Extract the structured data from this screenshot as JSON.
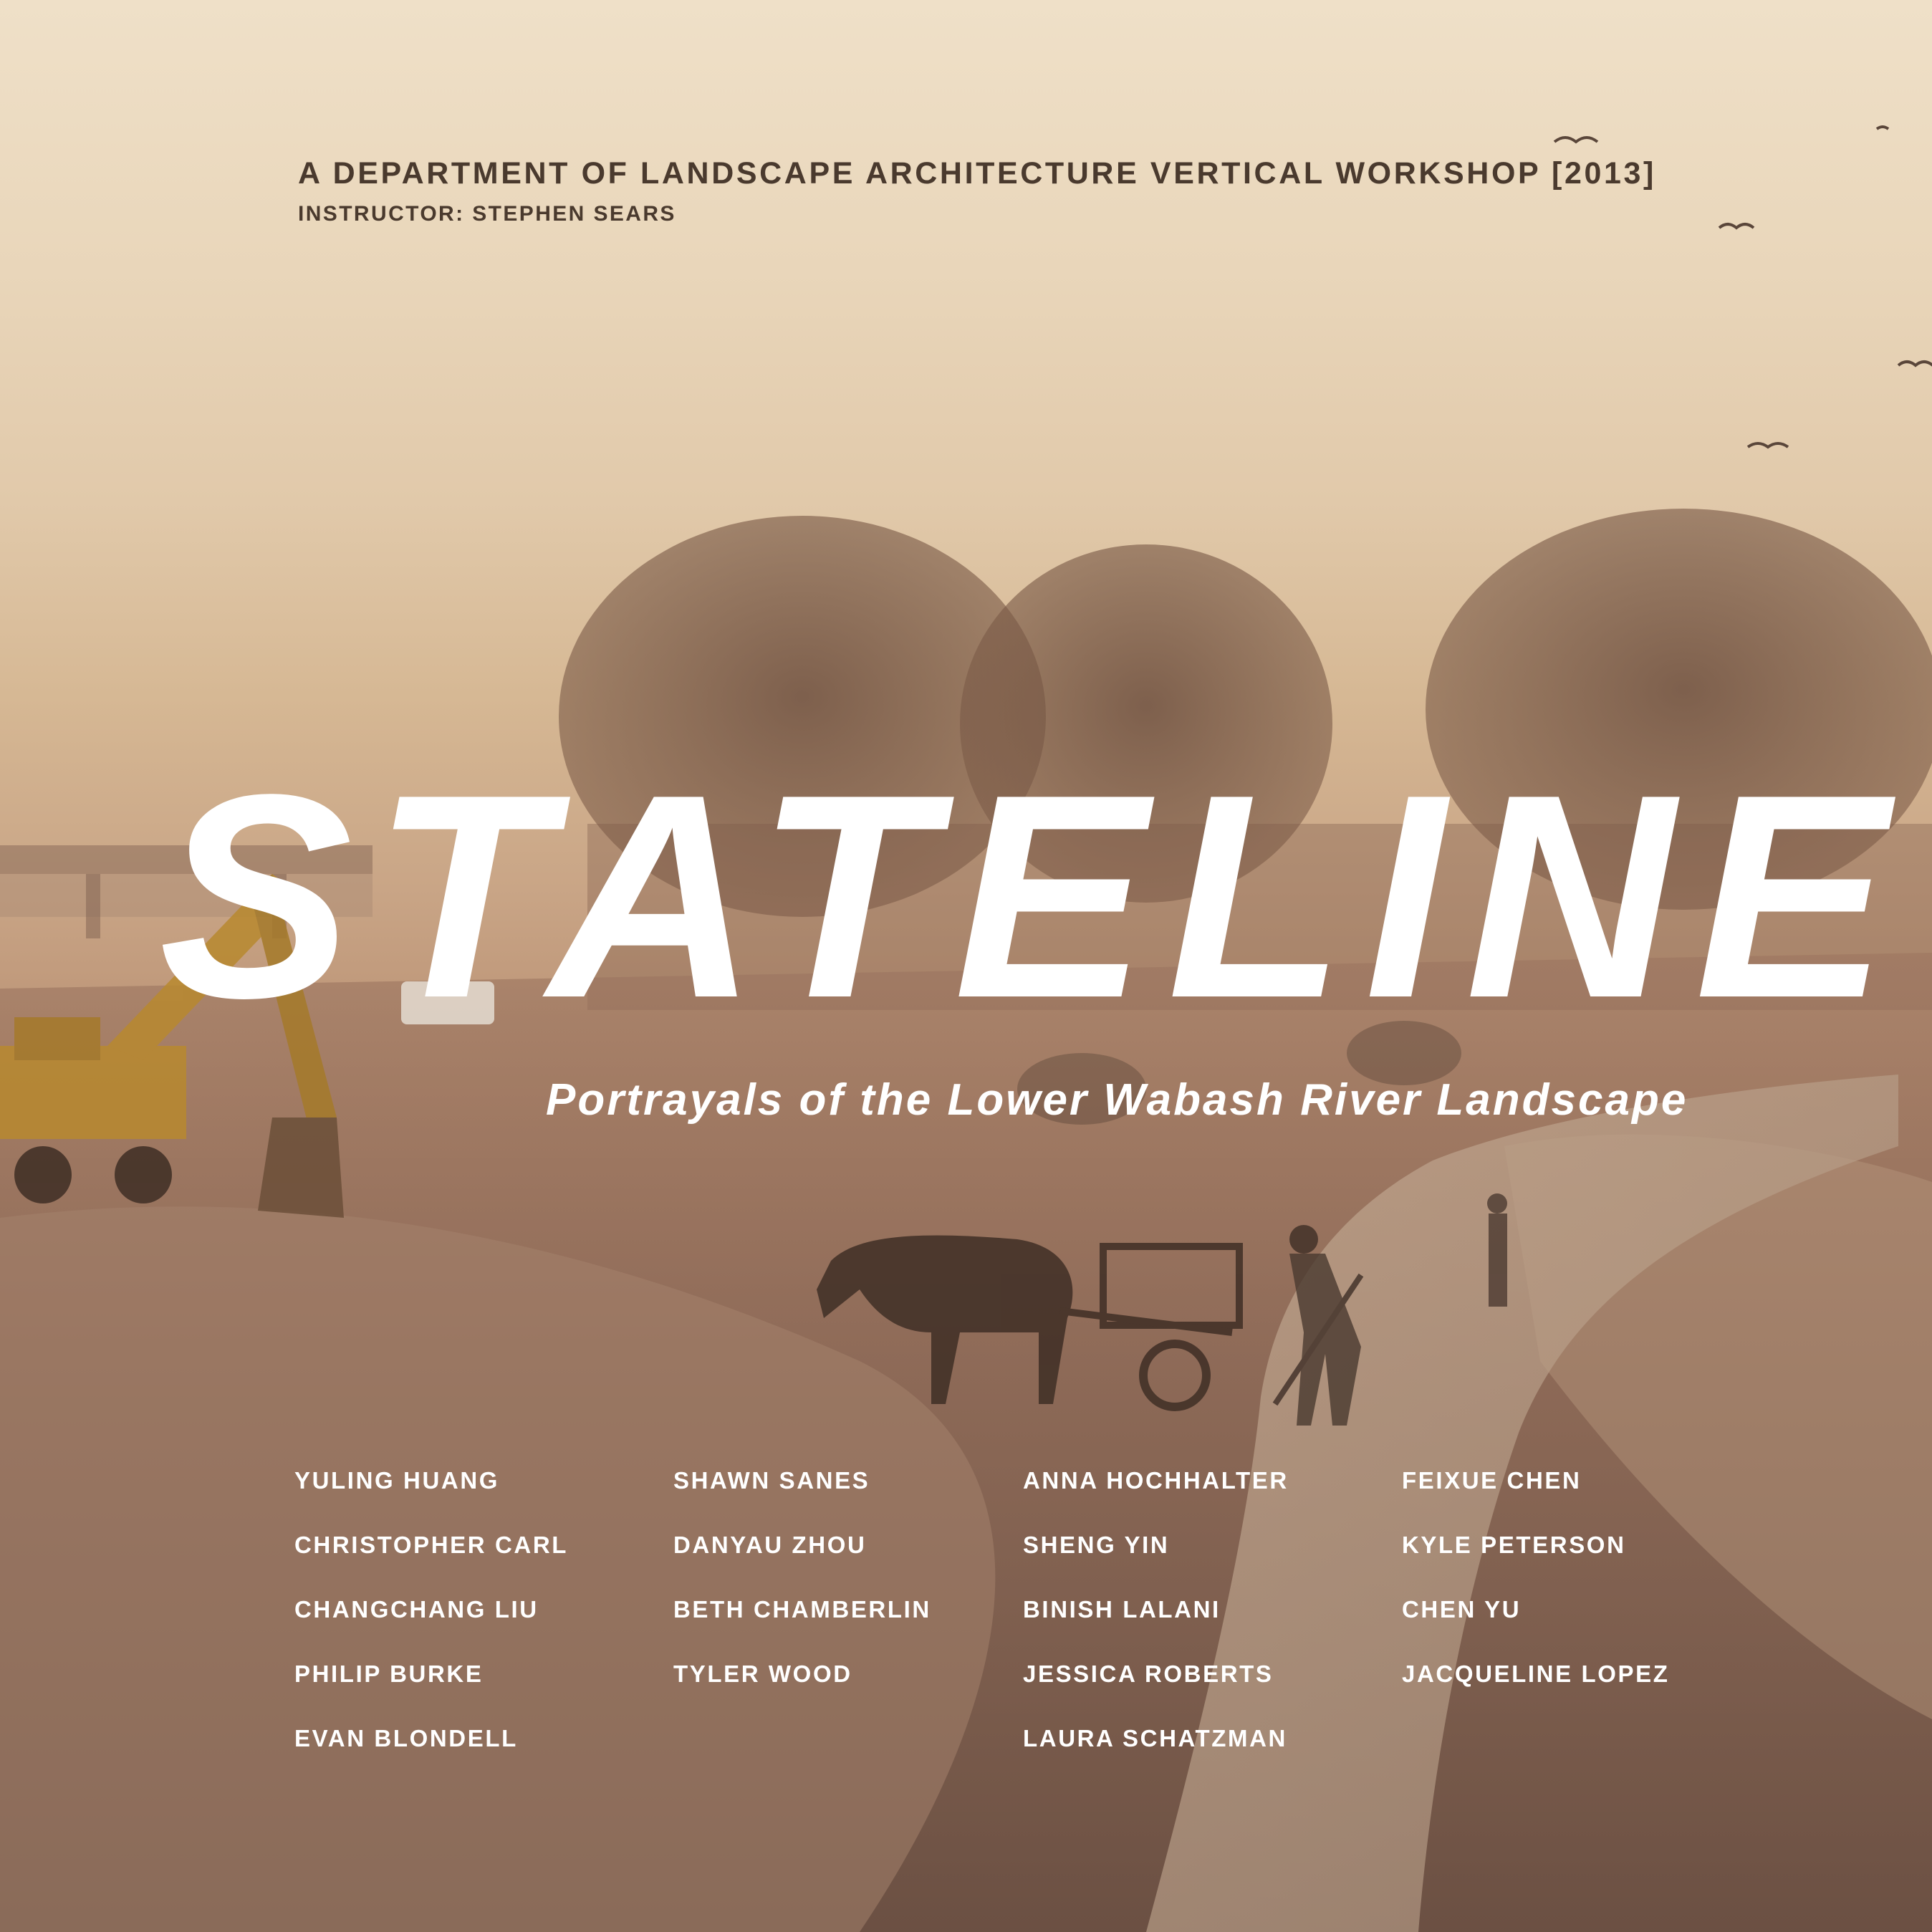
{
  "header": {
    "title": "A DEPARTMENT OF LANDSCAPE ARCHITECTURE VERTICAL WORKSHOP [2013]",
    "instructor": "INSTRUCTOR: STEPHEN SEARS"
  },
  "cover": {
    "title": "STATELINE",
    "subtitle": "Portrayals of the Lower Wabash River Landscape"
  },
  "names": {
    "col1": [
      "YULING HUANG",
      "CHRISTOPHER CARL",
      "CHANGCHANG LIU",
      "PHILIP BURKE",
      "EVAN BLONDELL"
    ],
    "col2": [
      "SHAWN SANES",
      "DANYAU ZHOU",
      "BETH CHAMBERLIN",
      "TYLER WOOD"
    ],
    "col3": [
      "ANNA HOCHHALTER",
      "SHENG YIN",
      "BINISH LALANI",
      "JESSICA ROBERTS",
      "LAURA SCHATZMAN"
    ],
    "col4": [
      "FEIXUE CHEN",
      "KYLE PETERSON",
      "CHEN YU",
      "JACQUELINE LOPEZ"
    ]
  }
}
